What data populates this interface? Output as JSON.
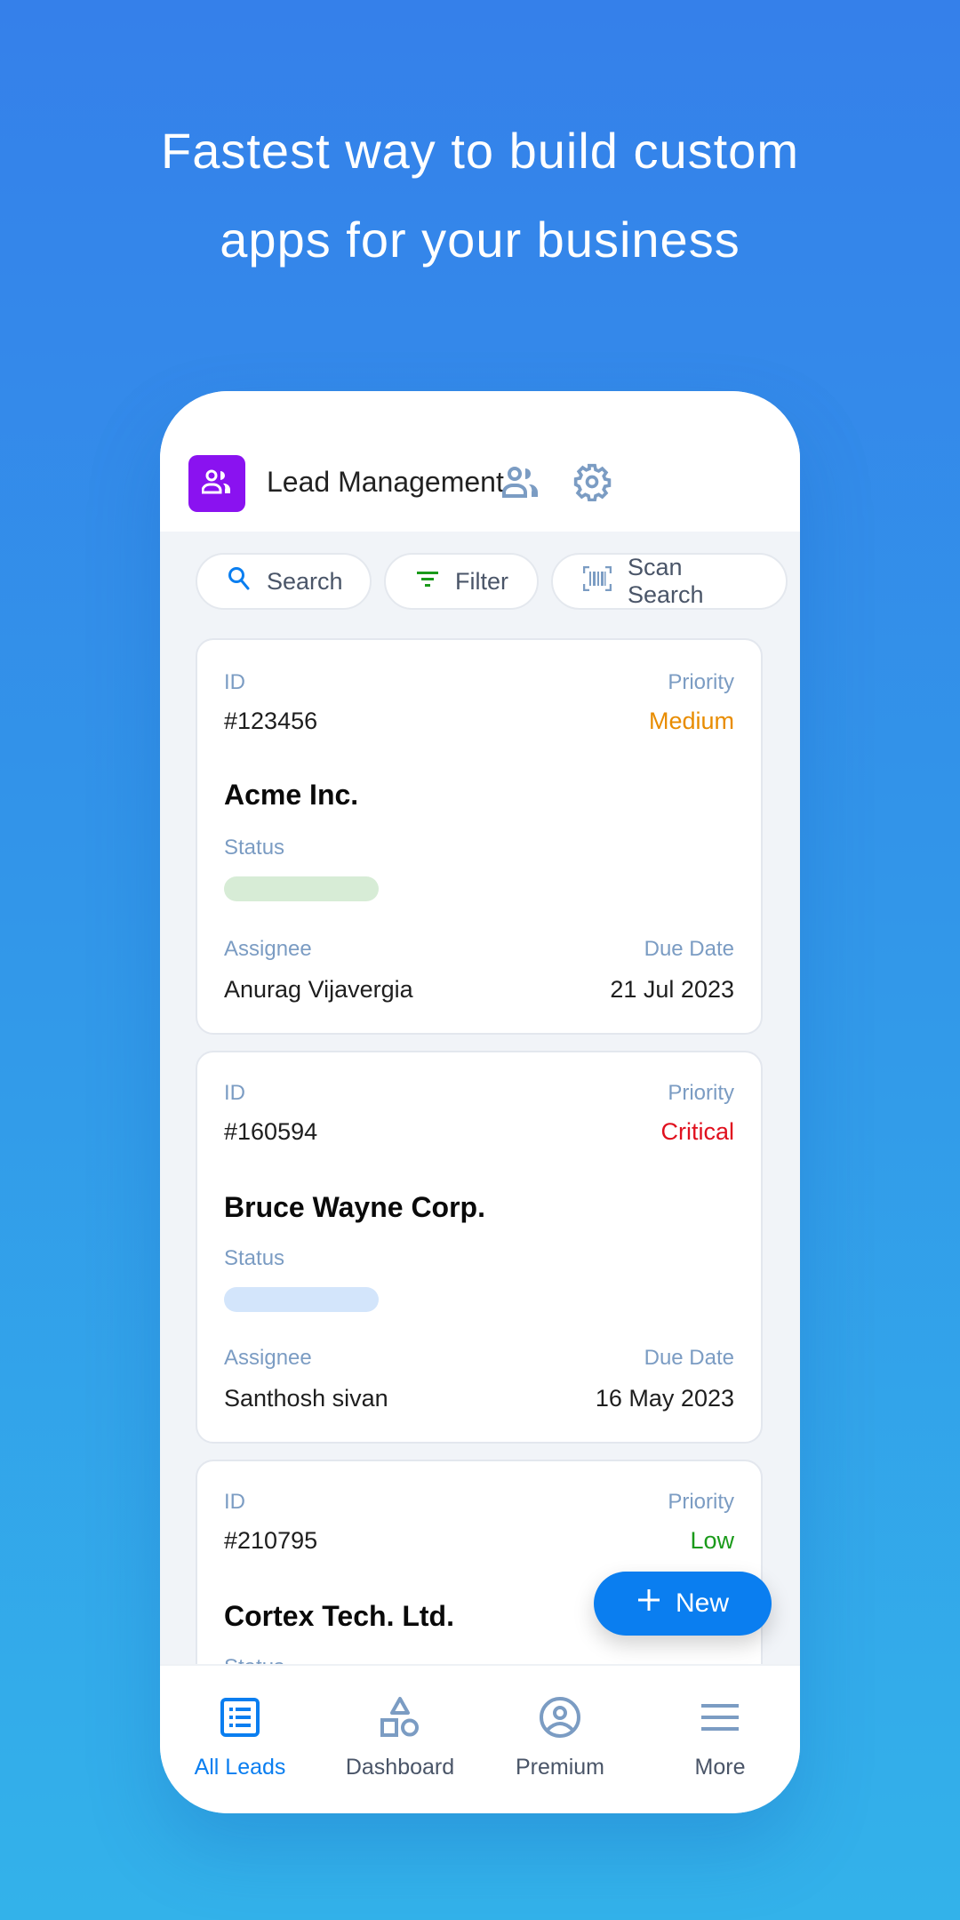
{
  "headline": {
    "line1": "Fastest way to build custom",
    "line2": "apps for your business"
  },
  "app": {
    "title": "Lead Management",
    "logo_icon": "users-icon",
    "actions": [
      {
        "icon": "users-icon",
        "label": "Users"
      },
      {
        "icon": "gear-icon",
        "label": "Settings"
      }
    ]
  },
  "toolbar": {
    "search_label": "Search",
    "filter_label": "Filter",
    "scan_label": "Scan Search"
  },
  "colors": {
    "accent": "#0a7ef0",
    "logo_bg": "#8a12f0",
    "priority_medium": "#e88c00",
    "priority_critical": "#e0101e",
    "priority_low": "#1a9a1a",
    "label": "#7b9cc3"
  },
  "labels": {
    "id": "ID",
    "priority": "Priority",
    "status": "Status",
    "assignee": "Assignee",
    "due_date": "Due Date"
  },
  "leads": [
    {
      "id": "#123456",
      "priority": "Medium",
      "company": "Acme Inc.",
      "status_color": "#d7ecd6",
      "assignee": "Anurag Vijavergia",
      "due_date": "21 Jul 2023"
    },
    {
      "id": "#160594",
      "priority": "Critical",
      "company": "Bruce Wayne Corp.",
      "status_color": "#d3e5fb",
      "assignee": "Santhosh sivan",
      "due_date": "16 May 2023"
    },
    {
      "id": "#210795",
      "priority": "Low",
      "company": "Cortex Tech. Ltd."
    }
  ],
  "fab": {
    "label": "New",
    "icon": "plus-icon"
  },
  "bottom_nav": [
    {
      "label": "All Leads",
      "icon": "list-icon",
      "active": true
    },
    {
      "label": "Dashboard",
      "icon": "shapes-icon",
      "active": false
    },
    {
      "label": "Premium",
      "icon": "account-circle-icon",
      "active": false
    },
    {
      "label": "More",
      "icon": "menu-icon",
      "active": false
    }
  ]
}
